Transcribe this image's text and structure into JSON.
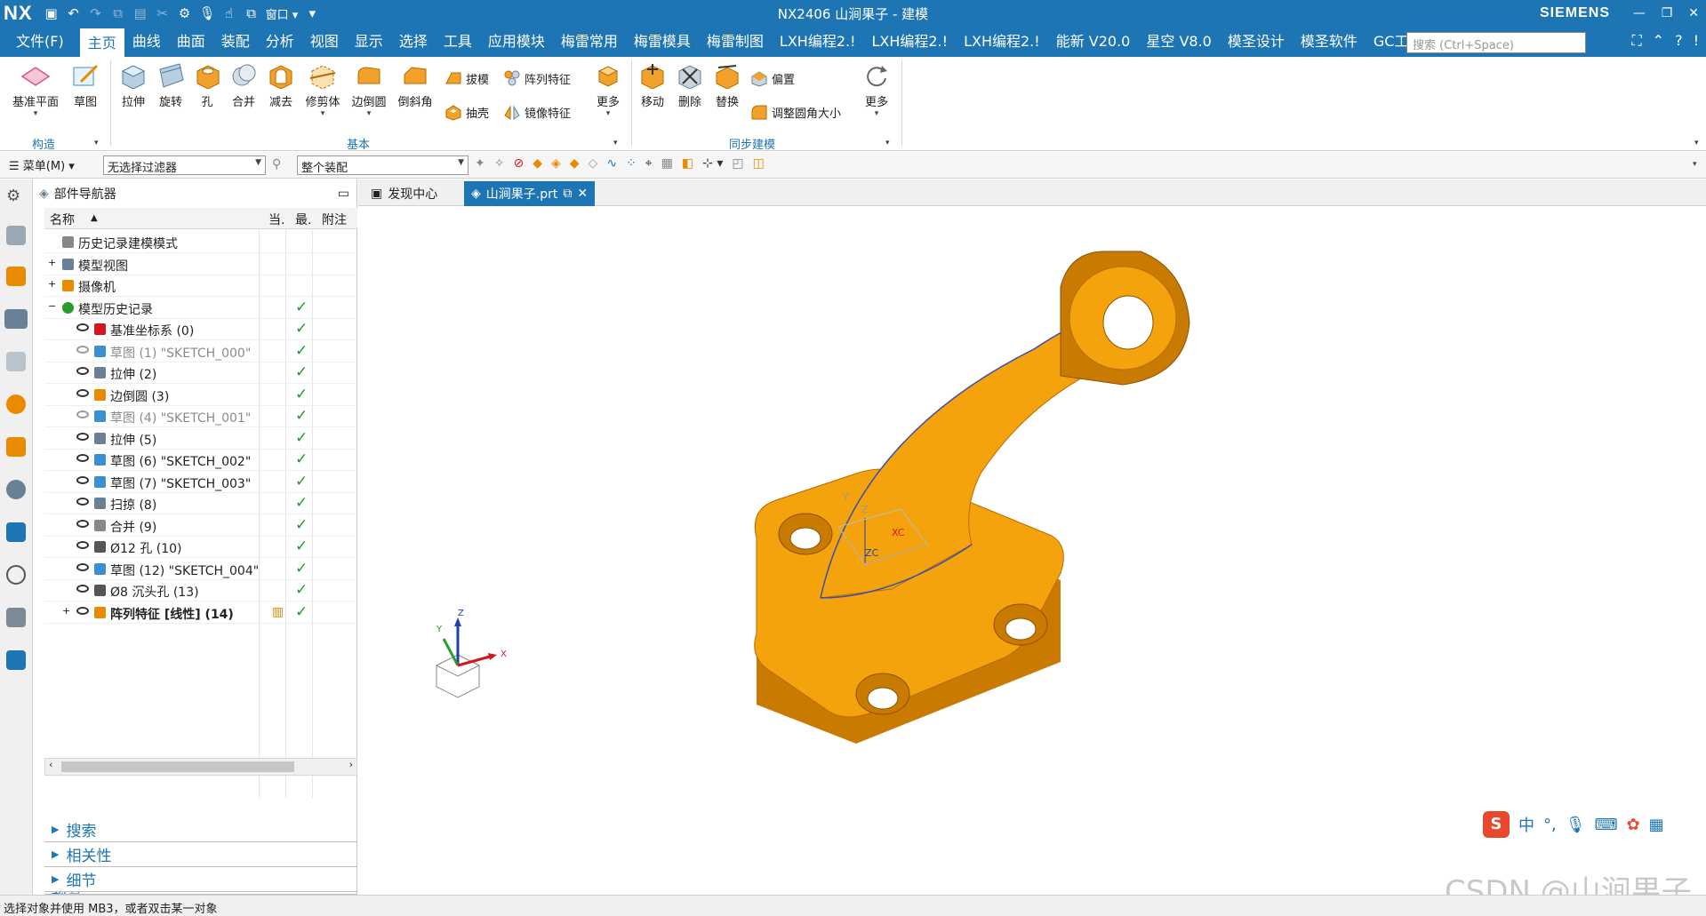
{
  "app": {
    "logo": "NX",
    "title": "NX2406 山涧果子 - 建模",
    "brand": "SIEMENS",
    "window_label": "窗口"
  },
  "menu": {
    "file": "文件(F)",
    "tabs": [
      "主页",
      "曲线",
      "曲面",
      "装配",
      "分析",
      "视图",
      "显示",
      "选择",
      "工具",
      "应用模块",
      "梅雷常用",
      "梅雷模具",
      "梅雷制图",
      "LXH编程2.!",
      "LXH编程2.!",
      "LXH编程2.!",
      "能新 V20.0",
      "星空 V8.0",
      "模圣设计",
      "模圣软件",
      "GC工具箱"
    ],
    "search_placeholder": "搜索 (Ctrl+Space)"
  },
  "ribbon": {
    "construct": {
      "datum_plane": "基准平面",
      "sketch": "草图",
      "label": "构造"
    },
    "basic": {
      "extrude": "拉伸",
      "revolve": "旋转",
      "hole": "孔",
      "unite": "合并",
      "subtract": "减去",
      "trim_body": "修剪体",
      "edge_blend": "边倒圆",
      "chamfer": "倒斜角",
      "draft": "拔模",
      "pattern": "阵列特征",
      "shell": "抽壳",
      "mirror": "镜像特征",
      "more": "更多",
      "label": "基本"
    },
    "sync": {
      "move": "移动",
      "delete": "删除",
      "replace": "替换",
      "offset": "偏置",
      "resize_blend": "调整圆角大小",
      "more": "更多",
      "label": "同步建模"
    }
  },
  "toolbar2": {
    "menu": "菜单(M)",
    "filter": "无选择过滤器",
    "scope": "整个装配"
  },
  "navigator": {
    "title": "部件导航器",
    "columns": [
      "名称",
      "当.",
      "最.",
      "附注"
    ],
    "rows": [
      {
        "label": "历史记录建模模式",
        "indent": 0,
        "gray": false,
        "check": false
      },
      {
        "label": "模型视图",
        "indent": 0,
        "gray": false,
        "check": false
      },
      {
        "label": "摄像机",
        "indent": 0,
        "gray": false,
        "check": false
      },
      {
        "label": "模型历史记录",
        "indent": 0,
        "gray": false,
        "check": true
      },
      {
        "label": "基准坐标系 (0)",
        "indent": 1,
        "gray": false,
        "check": true
      },
      {
        "label": "草图 (1) \"SKETCH_000\"",
        "indent": 1,
        "gray": true,
        "check": true
      },
      {
        "label": "拉伸 (2)",
        "indent": 1,
        "gray": false,
        "check": true
      },
      {
        "label": "边倒圆 (3)",
        "indent": 1,
        "gray": false,
        "check": true
      },
      {
        "label": "草图 (4) \"SKETCH_001\"",
        "indent": 1,
        "gray": true,
        "check": true
      },
      {
        "label": "拉伸 (5)",
        "indent": 1,
        "gray": false,
        "check": true
      },
      {
        "label": "草图 (6) \"SKETCH_002\"",
        "indent": 1,
        "gray": false,
        "check": true
      },
      {
        "label": "草图 (7) \"SKETCH_003\"",
        "indent": 1,
        "gray": false,
        "check": true
      },
      {
        "label": "扫掠 (8)",
        "indent": 1,
        "gray": false,
        "check": true
      },
      {
        "label": "合并 (9)",
        "indent": 1,
        "gray": false,
        "check": true
      },
      {
        "label": "Ø12 孔 (10)",
        "indent": 1,
        "gray": false,
        "check": true
      },
      {
        "label": "草图 (12) \"SKETCH_004\"",
        "indent": 1,
        "gray": false,
        "check": true
      },
      {
        "label": "Ø8 沉头孔 (13)",
        "indent": 1,
        "gray": false,
        "check": true
      },
      {
        "label": "阵列特征 [线性] (14)",
        "indent": 1,
        "gray": false,
        "check": true,
        "bold": true
      }
    ],
    "panels": [
      "搜索",
      "相关性",
      "细节",
      "预览"
    ]
  },
  "doc_tabs": [
    "发现中心",
    "山涧果子.prt"
  ],
  "axes": {
    "x": "X",
    "y": "Y",
    "z": "Z",
    "xc": "XC",
    "yc": "YC",
    "zc": "ZC"
  },
  "status": "选择对象并使用 MB3，或者双击某一对象",
  "watermark": "CSDN @山涧果子",
  "ime": {
    "lang": "中"
  },
  "colors": {
    "brand": "#1e75b4",
    "model": "#f5a30c",
    "model_dark": "#c97a00",
    "check": "#1a9c2a"
  }
}
